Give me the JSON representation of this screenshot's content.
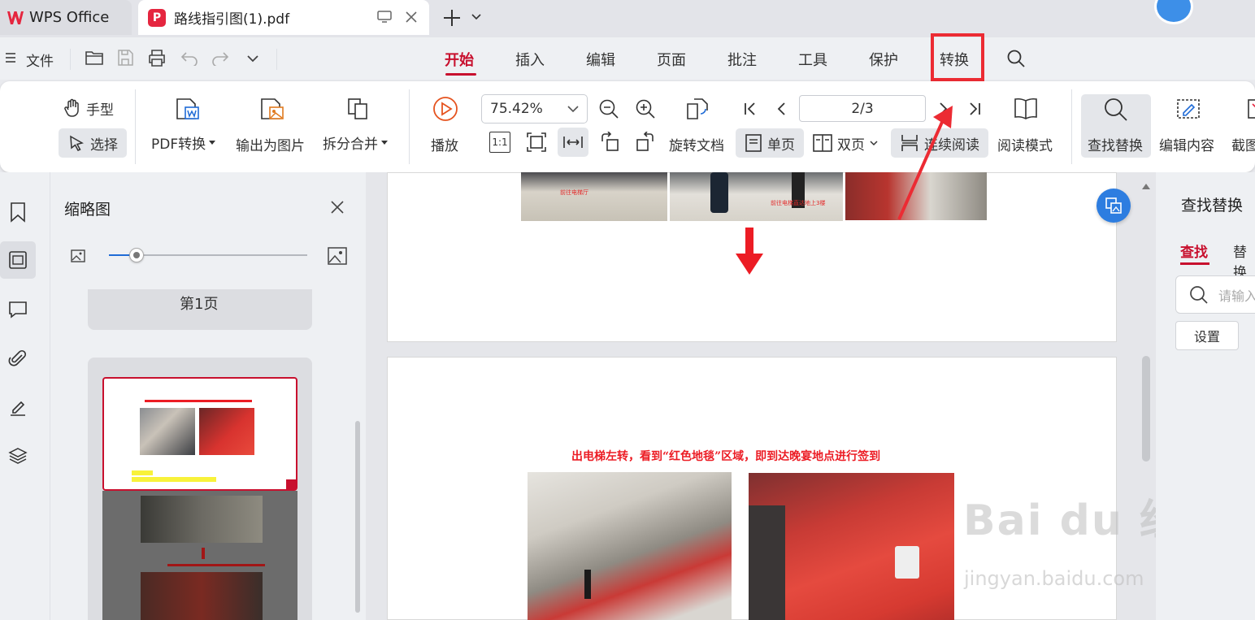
{
  "tabs": {
    "app_tab": "WPS Office",
    "doc_tab": "路线指引图(1).pdf"
  },
  "menu": {
    "file_label": "文件",
    "items": [
      "开始",
      "插入",
      "编辑",
      "页面",
      "批注",
      "工具",
      "保护",
      "转换"
    ],
    "active": "开始",
    "highlighted": "转换"
  },
  "ribbon": {
    "hand_label": "手型",
    "select_label": "选择",
    "pdf_convert_label": "PDF转换",
    "export_image_label": "输出为图片",
    "split_merge_label": "拆分合并",
    "play_label": "播放",
    "zoom_value": "75.42%",
    "fit_actual_label": "1:1",
    "rotate_doc_label": "旋转文档",
    "single_page_label": "单页",
    "double_page_label": "双页",
    "continuous_label": "连续阅读",
    "page_indicator": "2/3",
    "reading_mode_label": "阅读模式",
    "find_replace_label": "查找替换",
    "edit_content_label": "编辑内容",
    "screenshot_label": "截图"
  },
  "thumbnails": {
    "title": "缩略图",
    "page1_label": "第1页"
  },
  "document": {
    "page2_heading": "出电梯左转，看到“红色地毯”区域，即到达晚宴地点进行签到",
    "photo_caption_1": "前往电梯厅",
    "photo_caption_2": "前往电梯直达地上3楼"
  },
  "right_panel": {
    "title": "查找替换",
    "tab_find": "查找",
    "tab_replace": "替换",
    "search_placeholder": "请输入",
    "settings_label": "设置"
  },
  "watermark": {
    "logo_text": "Bai du 经验",
    "url": "jingyan.baidu.com"
  },
  "colors": {
    "accent": "#c8102e",
    "highlight_red": "#ec2b33",
    "ribbon_bg": "#ffffff",
    "panel_bg": "#eef0f3"
  }
}
